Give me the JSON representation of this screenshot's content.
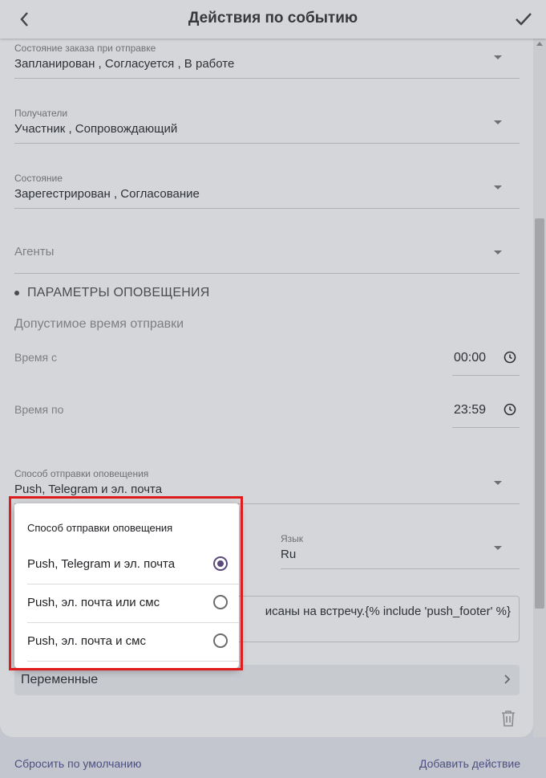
{
  "header": {
    "title": "Действия по событию"
  },
  "fields": {
    "order_state": {
      "label": "Состояние заказа при отправке",
      "value": "Запланирован , Согласуется , В работе"
    },
    "recipients": {
      "label": "Получатели",
      "value": "Участник , Сопровождающий"
    },
    "state": {
      "label": "Состояние",
      "value": "Зарегестрирован , Согласование"
    },
    "agents": {
      "placeholder": "Агенты"
    },
    "send_method": {
      "label": "Способ отправки оповещения",
      "value": "Push, Telegram и эл. почта"
    },
    "language": {
      "label": "Язык",
      "value": "Ru"
    }
  },
  "section": {
    "title": "ПАРАМЕТРЫ ОПОВЕЩЕНИЯ",
    "subtitle": "Допустимое время отправки"
  },
  "time_from": {
    "label": "Время с",
    "value": "00:00"
  },
  "time_to": {
    "label": "Время по",
    "value": "23:59"
  },
  "message_text": "исаны на встречу.{% include 'push_footer' %}",
  "variables": {
    "label": "Переменные"
  },
  "footer": {
    "reset": "Сбросить по умолчанию",
    "add": "Добавить действие"
  },
  "popup": {
    "title": "Способ отправки оповещения",
    "options": [
      {
        "label": "Push, Telegram и эл. почта",
        "selected": true
      },
      {
        "label": "Push, эл. почта или смс",
        "selected": false
      },
      {
        "label": "Push, эл. почта и смс",
        "selected": false
      }
    ]
  },
  "colors": {
    "accent": "#5a4a7a",
    "highlight": "#e01b1b",
    "link": "#4a4a8a"
  },
  "icons": [
    "back-arrow-icon",
    "check-icon",
    "chevron-down-icon",
    "clock-icon",
    "chevron-right-icon",
    "trash-icon"
  ]
}
